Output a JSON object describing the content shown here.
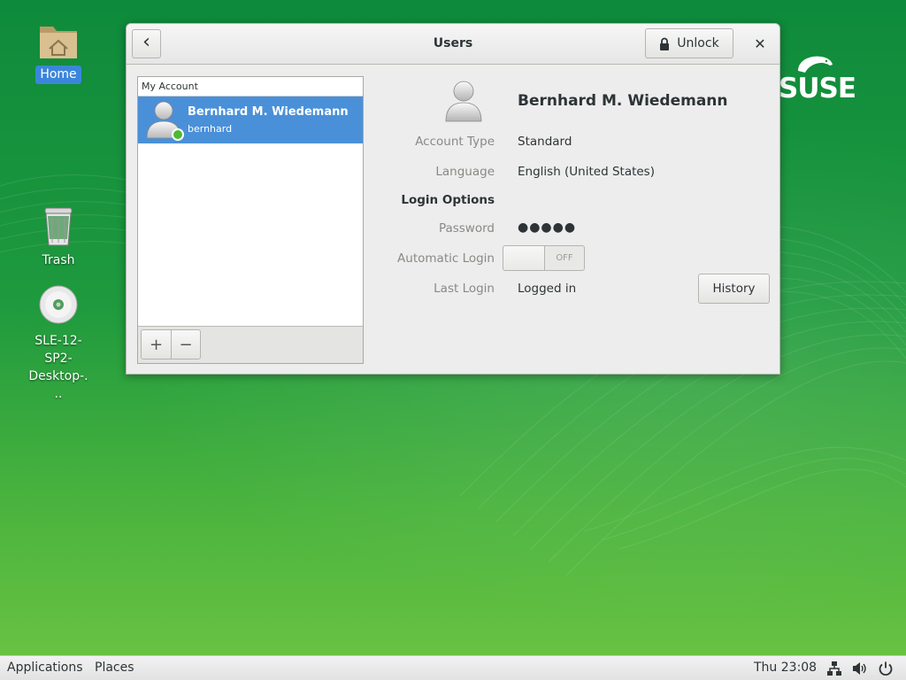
{
  "desktop": {
    "icons": [
      {
        "label": "Home"
      },
      {
        "label": "Trash"
      },
      {
        "label": "SLE-12-SP2-Desktop-..."
      }
    ],
    "brand_text": "SUSE"
  },
  "window": {
    "title": "Users",
    "unlock_label": "Unlock",
    "close_glyph": "✕",
    "back_glyph": "‹"
  },
  "accounts": {
    "section_label": "My Account",
    "users": [
      {
        "full_name": "Bernhard M. Wiedemann",
        "username": "bernhard",
        "status": "online"
      }
    ],
    "add_glyph": "+",
    "remove_glyph": "−"
  },
  "details": {
    "name": "Bernhard M. Wiedemann",
    "account_type_label": "Account Type",
    "account_type_value": "Standard",
    "language_label": "Language",
    "language_value": "English (United States)",
    "login_options_label": "Login Options",
    "password_label": "Password",
    "password_value": "●●●●●",
    "auto_login_label": "Automatic Login",
    "auto_login_state": "OFF",
    "last_login_label": "Last Login",
    "last_login_value": "Logged in",
    "history_label": "History"
  },
  "panel": {
    "applications": "Applications",
    "places": "Places",
    "clock": "Thu 23:08",
    "icons": [
      "network-icon",
      "volume-icon",
      "power-icon"
    ]
  },
  "colors": {
    "selection": "#4a90d9",
    "online": "#4fb931",
    "desktop_green": "#1f9a3e"
  }
}
